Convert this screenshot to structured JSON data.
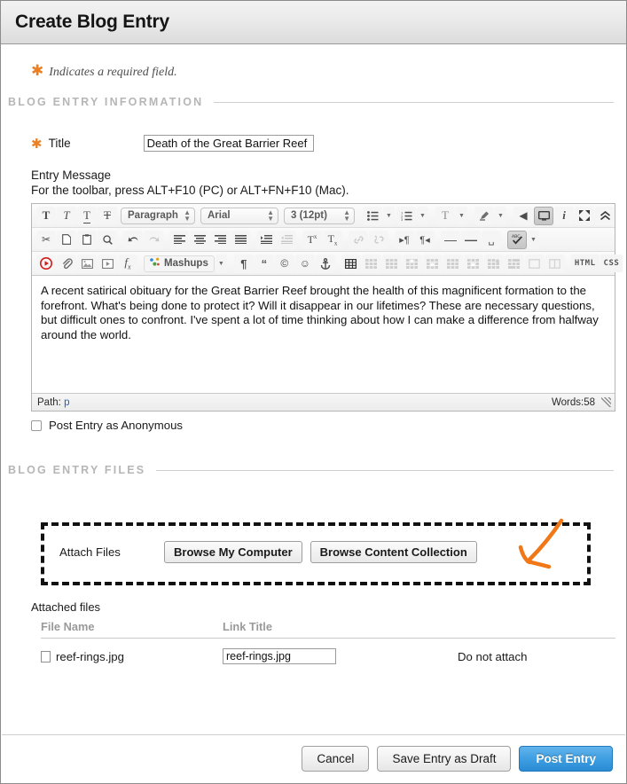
{
  "header": {
    "title": "Create Blog Entry"
  },
  "required_note": {
    "star": "✱",
    "text": "Indicates a required field."
  },
  "sections": {
    "info": {
      "label": "BLOG ENTRY INFORMATION"
    },
    "files": {
      "label": "BLOG ENTRY FILES"
    }
  },
  "form": {
    "title_star": "✱",
    "title_label": "Title",
    "title_value": "Death of the Great Barrier Reef",
    "title_placeholder": "",
    "entry_message_label": "Entry Message",
    "toolbar_hint": "For the toolbar, press ALT+F10 (PC) or ALT+FN+F10 (Mac).",
    "anonymous_label": "Post Entry as Anonymous",
    "anonymous_checked": false
  },
  "editor": {
    "selects": {
      "format": "Paragraph",
      "font": "Arial",
      "size": "3 (12pt)"
    },
    "code_buttons": [
      "HTML",
      "CSS"
    ],
    "mashups_label": "Mashups",
    "body_text": "A recent satirical obituary for the Great Barrier Reef brought the health of this magnificent formation to the forefront. What's being done to protect it? Will it disappear in our lifetimes? These are necessary questions, but difficult ones to confront. I've spent a lot of time thinking about how I can make a difference from halfway around the world.",
    "status": {
      "path_label": "Path:",
      "path_value": "p",
      "words": "Words:58"
    }
  },
  "attach": {
    "label": "Attach Files",
    "browse_computer": "Browse My Computer",
    "browse_collection": "Browse Content Collection",
    "attached_label": "Attached files",
    "columns": [
      "File Name",
      "Link Title"
    ],
    "rows": [
      {
        "file_name": "reef-rings.jpg",
        "link_title": "reef-rings.jpg",
        "action": "Do not attach"
      }
    ]
  },
  "footer": {
    "cancel": "Cancel",
    "save_draft": "Save Entry as Draft",
    "post": "Post Entry"
  },
  "colors": {
    "required_star": "#eb7f22",
    "annotation_arrow": "#f07818",
    "primary_button": "#3f9fe2",
    "section_label": "#b6b6b6"
  }
}
